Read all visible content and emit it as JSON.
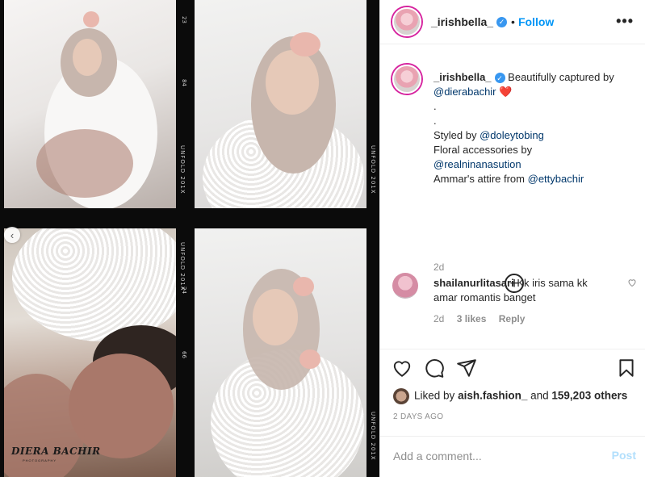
{
  "post": {
    "watermark": "DIERA BACHIR",
    "watermark_sub": "PHOTOGRAPHY",
    "film_edge_text": [
      "UNFOLD 201X",
      "UNFOLD 201X",
      "UNFOLD 201X",
      "UNFOLD 201X"
    ],
    "frame_numbers": [
      "23",
      "84",
      "24",
      "66"
    ]
  },
  "header": {
    "username": "_irishbella_",
    "verified": true,
    "separator": "•",
    "follow_label": "Follow",
    "more_label": "•••"
  },
  "caption": {
    "username": "_irishbella_",
    "lines": {
      "intro": "Beautifully captured by",
      "photographer": "@dierabachir",
      "heart": "❤️",
      "dot1": ".",
      "dot2": ".",
      "styled_by": "Styled by",
      "stylist": "@doleytobing",
      "floral": "Floral accessories by",
      "florist": "@realninanasution",
      "attire": "Ammar's attire from",
      "attire_handle": "@ettybachir"
    },
    "age": "2d"
  },
  "load_more_label": "+",
  "comment": {
    "username": "shailanurlitasari",
    "text": "Kk iris sama kk amar romantis banget",
    "age": "2d",
    "likes": "3 likes",
    "reply": "Reply"
  },
  "actions": {
    "liked_by_prefix": "Liked by",
    "liked_by_user": "aish.fashion_",
    "and": "and",
    "others": "159,203 others",
    "timestamp": "2 DAYS AGO"
  },
  "add_comment": {
    "placeholder": "Add a comment...",
    "post_label": "Post"
  },
  "colors": {
    "accent": "#0095f6",
    "verified": "#3897f0",
    "muted": "#8e8e8e",
    "mention": "#00376b",
    "post_disabled": "#b2dffc"
  }
}
